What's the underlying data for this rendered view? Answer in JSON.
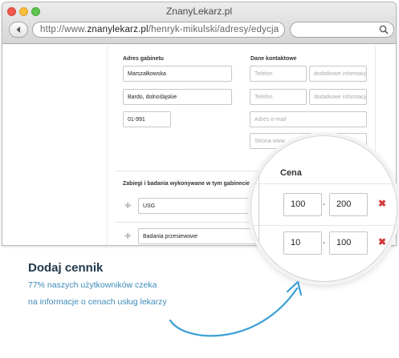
{
  "window": {
    "title": "ZnanyLekarz.pl"
  },
  "browser": {
    "url_prefix": "http://www.",
    "url_domain": "znanylekarz.pl",
    "url_path": "/henryk-mikulski/adresy/edycja",
    "search_value": ""
  },
  "form": {
    "address_label": "Adres gabinetu",
    "street": "Marszałkowska",
    "city": "Bardo,  dolnośląskie",
    "postcode": "01-991",
    "contact_label": "Dane kontaktowe",
    "phone_placeholder_1": "Telefon",
    "extra_info_placeholder_1": "dodatkowe informacje",
    "phone_placeholder_2": "Telefon",
    "extra_info_placeholder_2": "dodatkowe informacje",
    "email_placeholder": "Adres e-mail",
    "website_placeholder": "Strona www",
    "services_label": "Zabiegi i badania wykonywane w tym gabinecie",
    "services": [
      {
        "name": "USG"
      },
      {
        "name": "Badania przesiewowe"
      }
    ]
  },
  "price": {
    "label": "Cena",
    "rows": [
      {
        "min": "100",
        "max": "200"
      },
      {
        "min": "10",
        "max": "100"
      }
    ],
    "separator": "-",
    "remove_symbol": "✖"
  },
  "promo": {
    "title": "Dodaj cennik",
    "line1": "77% naszych użytkowników czeka",
    "line2": "na informacje o cenach usług lekarzy"
  },
  "colors": {
    "promo_title": "#243a4c",
    "promo_text": "#3d8ab8",
    "arrow": "#3a9fd6",
    "remove": "#d23b3b"
  }
}
